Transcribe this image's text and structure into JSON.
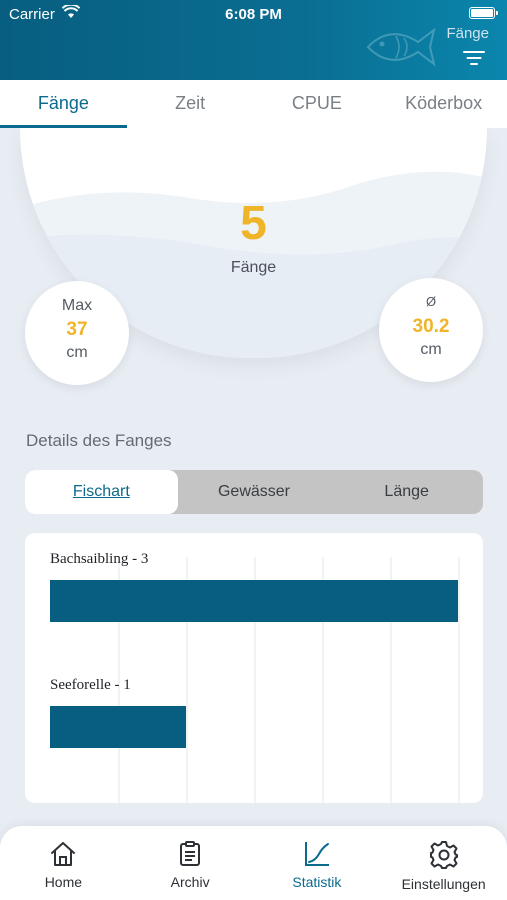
{
  "status_bar": {
    "carrier": "Carrier",
    "time": "6:08 PM"
  },
  "header": {
    "filter_label": "Fänge"
  },
  "tabs": [
    {
      "label": "Fänge",
      "active": true
    },
    {
      "label": "Zeit",
      "active": false
    },
    {
      "label": "CPUE",
      "active": false
    },
    {
      "label": "Köderbox",
      "active": false
    }
  ],
  "summary": {
    "count": "5",
    "count_label": "Fänge",
    "max": {
      "label": "Max",
      "value": "37",
      "unit": "cm"
    },
    "avg": {
      "label": "Ø",
      "value": "30.2",
      "unit": "cm"
    }
  },
  "details": {
    "title": "Details des Fanges",
    "segments": [
      {
        "label": "Fischart",
        "active": true
      },
      {
        "label": "Gewässer",
        "active": false
      },
      {
        "label": "Länge",
        "active": false
      }
    ]
  },
  "chart_data": {
    "type": "bar",
    "orientation": "horizontal",
    "categories": [
      "Bachsaibling - 3",
      "Seeforelle - 1"
    ],
    "values": [
      3,
      1
    ],
    "xlim": [
      0,
      3
    ],
    "grid": true,
    "bar_color": "#075e80"
  },
  "bottom_nav": [
    {
      "label": "Home",
      "icon": "home-icon",
      "active": false
    },
    {
      "label": "Archiv",
      "icon": "clipboard-icon",
      "active": false
    },
    {
      "label": "Statistik",
      "icon": "chart-curve-icon",
      "active": true
    },
    {
      "label": "Einstellungen",
      "icon": "gear-icon",
      "active": false
    }
  ],
  "colors": {
    "accent": "#0b6a8d",
    "highlight": "#f0b429",
    "header": "#075e80"
  }
}
